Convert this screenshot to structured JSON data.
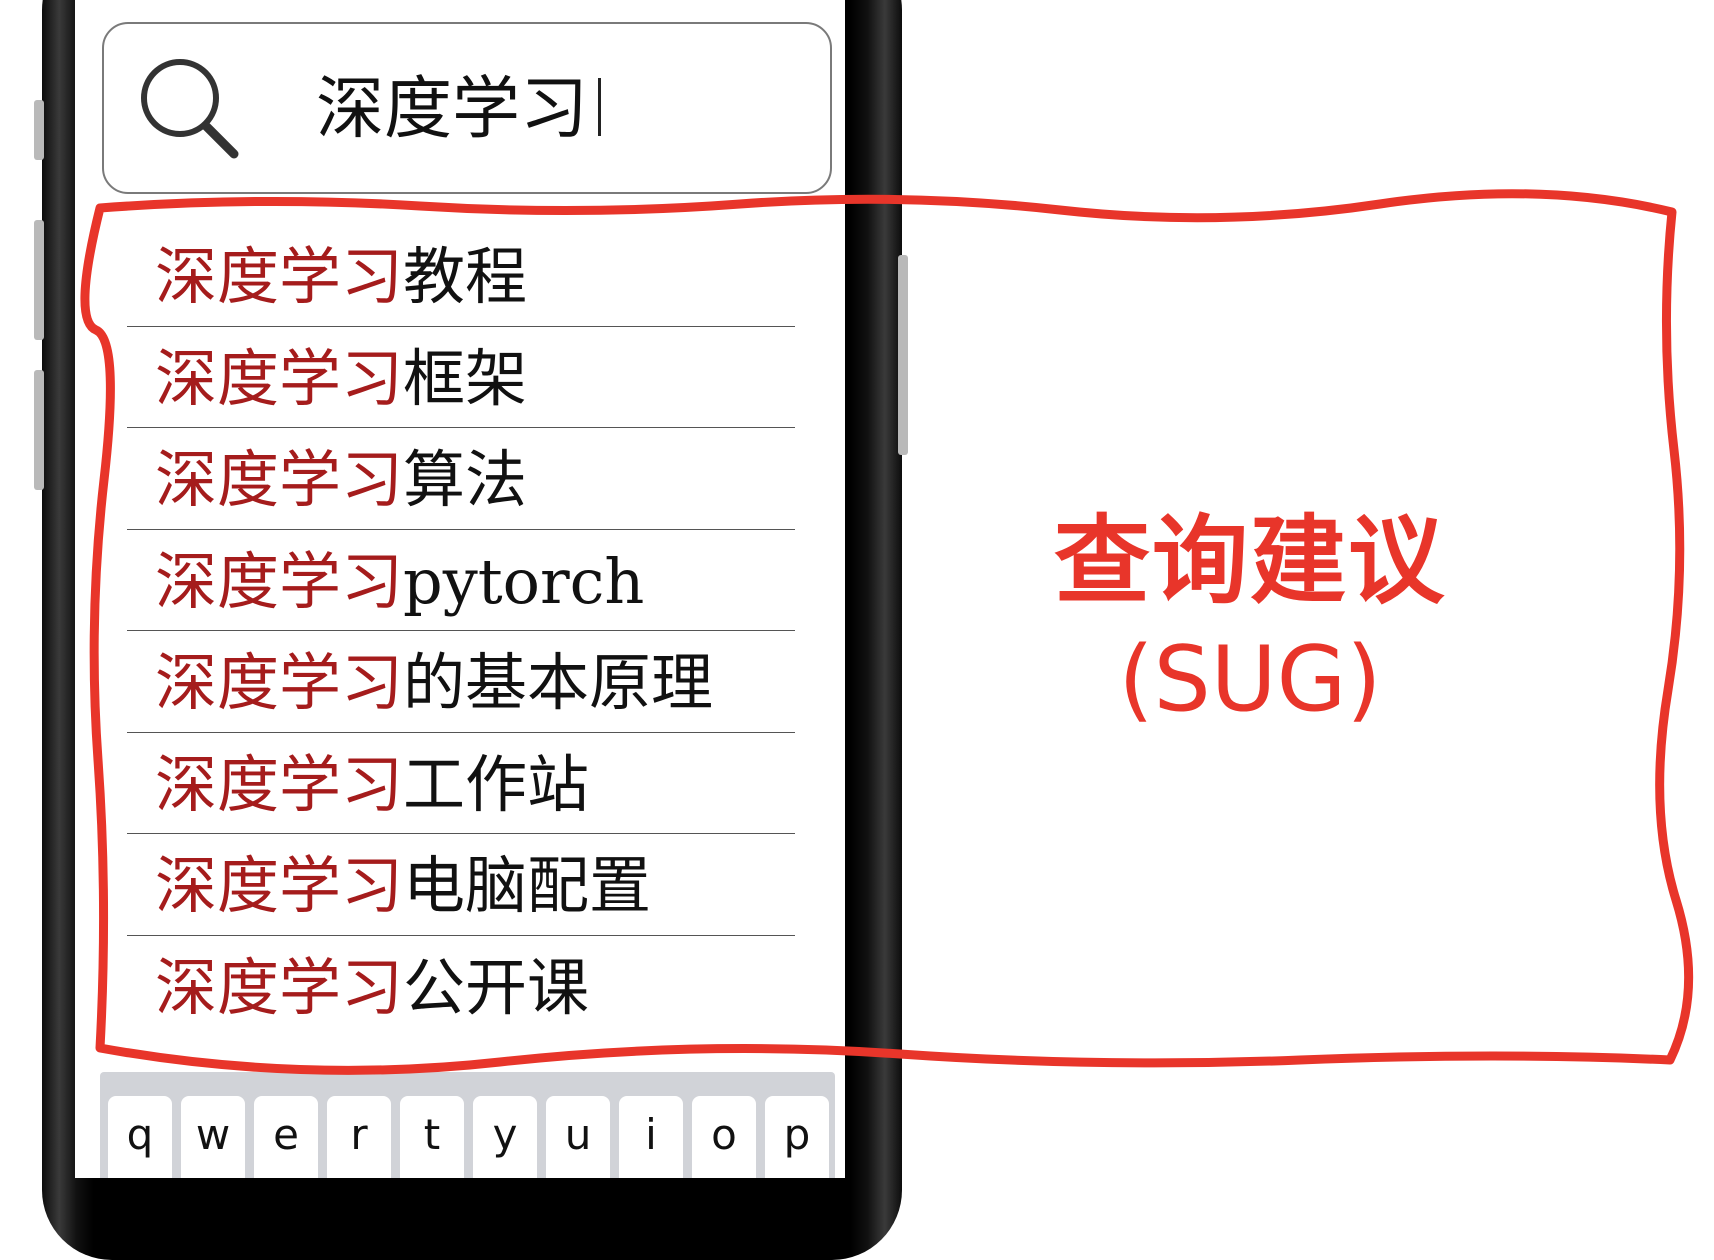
{
  "search": {
    "query": "深度学习"
  },
  "suggestions": [
    {
      "prefix": "深度学习",
      "suffix": "教程"
    },
    {
      "prefix": "深度学习",
      "suffix": "框架"
    },
    {
      "prefix": "深度学习",
      "suffix": "算法"
    },
    {
      "prefix": "深度学习",
      "suffix": "pytorch"
    },
    {
      "prefix": "深度学习",
      "suffix": "的基本原理"
    },
    {
      "prefix": "深度学习",
      "suffix": "工作站"
    },
    {
      "prefix": "深度学习",
      "suffix": "电脑配置"
    },
    {
      "prefix": "深度学习",
      "suffix": "公开课"
    }
  ],
  "keyboard": {
    "row1": [
      "q",
      "w",
      "e",
      "r",
      "t",
      "y",
      "u",
      "i",
      "o",
      "p"
    ]
  },
  "annotation": {
    "label": "查询建议",
    "sublabel": "(SUG)",
    "color": "#e8352a"
  },
  "colors": {
    "highlight_prefix": "#a51c1c",
    "suffix_text": "#111111"
  }
}
